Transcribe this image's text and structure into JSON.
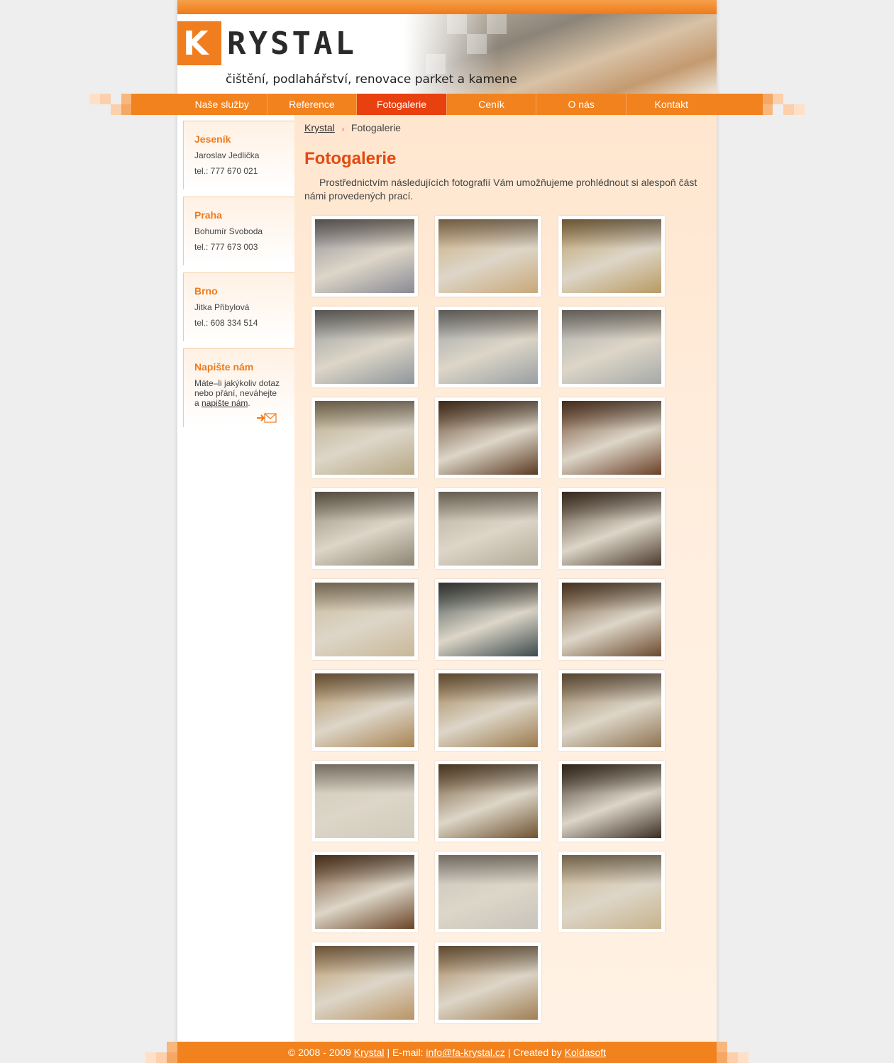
{
  "brand": {
    "logo_letter": "K",
    "logo_word": "RYSTAL",
    "tagline": "čištění, podlahářství, renovace parket a kamene"
  },
  "nav": {
    "items": [
      "Naše služby",
      "Reference",
      "Fotogalerie",
      "Ceník",
      "O nás",
      "Kontakt"
    ],
    "active": "Fotogalerie"
  },
  "sidebar": {
    "offices": [
      {
        "city": "Jeseník",
        "person": "Jaroslav Jedlička",
        "phone": "tel.: 777 670 021"
      },
      {
        "city": "Praha",
        "person": "Bohumír Svoboda",
        "phone": "tel.: 777 673 003"
      },
      {
        "city": "Brno",
        "person": "Jitka Přibylová",
        "phone": "tel.: 608 334 514"
      }
    ],
    "contact": {
      "title": "Napište nám",
      "text_before": "Máte–li jakýkoliv dotaz nebo přání, neváhejte a",
      "link": "napište nám",
      "text_after": "."
    }
  },
  "breadcrumb": {
    "home": "Krystal",
    "current": "Fotogalerie"
  },
  "page": {
    "title": "Fotogalerie",
    "intro": "Prostřednictvím následujících fotografií Vám umožňujeme prohlédnout si alespoň část námi provedených prací."
  },
  "gallery": {
    "count": 26,
    "tones": [
      "#8a8a94",
      "#c9a87a",
      "#b99a62",
      "#8f969a",
      "#9a9fa3",
      "#a6a9a8",
      "#b6a784",
      "#5a3a22",
      "#6a4028",
      "#8d8572",
      "#b1aa98",
      "#4a3a2c",
      "#c8b898",
      "#3c4a4c",
      "#6a4a2e",
      "#a88454",
      "#9b7a4c",
      "#8d7352",
      "#d0cbbb",
      "#6e5230",
      "#3a2e22",
      "#6a4426",
      "#c8c4bc",
      "#c7b38c",
      "#b99466",
      "#a07e54"
    ]
  },
  "footer": {
    "copyright": "© 2008 - 2009",
    "site": "Krystal",
    "email_label": "| E-mail:",
    "email": "info@fa-krystal.cz",
    "created_label": "| Created by",
    "creator": "Koldasoft"
  },
  "colors": {
    "accent": "#f2821e",
    "active_nav": "#e8400f",
    "title": "#e24a10"
  }
}
